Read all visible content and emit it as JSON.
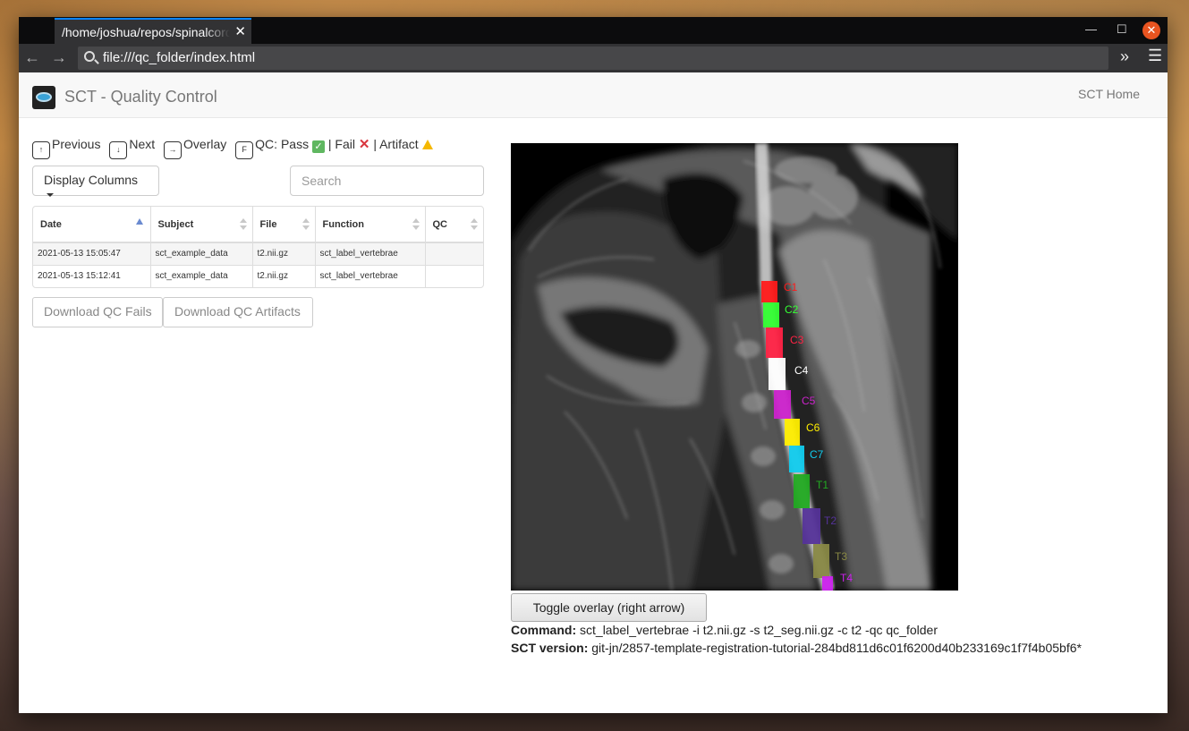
{
  "browser": {
    "tab_title": "/home/joshua/repos/spinalcordtoolbox",
    "url": "file:///qc_folder/index.html"
  },
  "header": {
    "title": "SCT - Quality Control",
    "home_link": "SCT Home"
  },
  "shortcuts": {
    "previous": {
      "key": "↑",
      "label": "Previous"
    },
    "next": {
      "key": "↓",
      "label": "Next"
    },
    "overlay": {
      "key": "→",
      "label": "Overlay"
    },
    "qc": {
      "key": "F",
      "label": "QC: Pass",
      "sep1": "| Fail",
      "sep2": "| Artifact"
    }
  },
  "toolbar": {
    "display_columns": "Display Columns",
    "search_placeholder": "Search"
  },
  "table": {
    "columns": [
      "Date",
      "Subject",
      "File",
      "Function",
      "QC"
    ],
    "rows": [
      {
        "date": "2021-05-13 15:05:47",
        "subject": "sct_example_data",
        "file": "t2.nii.gz",
        "function": "sct_label_vertebrae",
        "qc": ""
      },
      {
        "date": "2021-05-13 15:12:41",
        "subject": "sct_example_data",
        "file": "t2.nii.gz",
        "function": "sct_label_vertebrae",
        "qc": ""
      }
    ]
  },
  "downloads": {
    "fails": "Download QC Fails",
    "artifacts": "Download QC Artifacts"
  },
  "viewer": {
    "toggle_label": "Toggle overlay (right arrow)",
    "command_label": "Command:",
    "command": "sct_label_vertebrae -i t2.nii.gz -s t2_seg.nii.gz -c t2 -qc qc_folder",
    "version_label": "SCT version:",
    "version": "git-jn/2857-template-registration-tutorial-284bd811d6c01f6200d40b233169c1f7f4b05bf6*",
    "vertebrae": [
      {
        "name": "C1",
        "color": "#ff1a1a"
      },
      {
        "name": "C2",
        "color": "#33ff33"
      },
      {
        "name": "C3",
        "color": "#ff2244"
      },
      {
        "name": "C4",
        "color": "#ffffff"
      },
      {
        "name": "C5",
        "color": "#cc22cc"
      },
      {
        "name": "C6",
        "color": "#ffee00"
      },
      {
        "name": "C7",
        "color": "#11ccee"
      },
      {
        "name": "T1",
        "color": "#22aa22"
      },
      {
        "name": "T2",
        "color": "#553399"
      },
      {
        "name": "T3",
        "color": "#888844"
      },
      {
        "name": "T4",
        "color": "#cc22ee"
      }
    ]
  }
}
